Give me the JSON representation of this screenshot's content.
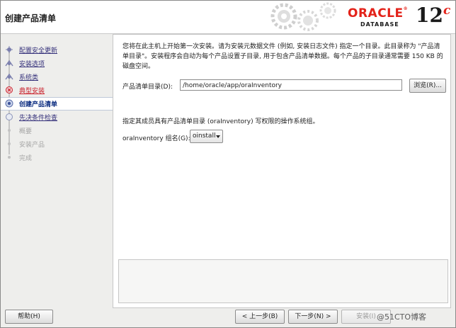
{
  "window": {
    "title": "创建产品清单"
  },
  "logo": {
    "brand": "ORACLE",
    "product": "DATABASE",
    "version": "12",
    "version_suffix": "c",
    "brand_color": "#e32219"
  },
  "sidebar": {
    "items": [
      {
        "label": "配置安全更新",
        "state": "done"
      },
      {
        "label": "安装选项",
        "state": "done"
      },
      {
        "label": "系统类",
        "state": "done"
      },
      {
        "label": "典型安装",
        "state": "warning"
      },
      {
        "label": "创建产品清单",
        "state": "current"
      },
      {
        "label": "先决条件检查",
        "state": "next"
      },
      {
        "label": "概要",
        "state": "disabled"
      },
      {
        "label": "安装产品",
        "state": "disabled"
      },
      {
        "label": "完成",
        "state": "disabled"
      }
    ]
  },
  "main": {
    "intro_text": "您将在此主机上开始第一次安装。请为安装元数据文件 (例如, 安装日志文件) 指定一个目录。此目录称为 \"产品清单目录\"。安装程序会自动为每个产品设置子目录, 用于包含产品清单数据。每个产品的子目录通常需要 150 KB 的磁盘空间。",
    "inventory_label": "产品清单目录(D):",
    "inventory_value": "/home/oracle/app/oraInventory",
    "browse_button": "浏览(R)...",
    "group_intro": "指定其成员具有产品清单目录 (oraInventory) 写权限的操作系统组。",
    "group_label": "oraInventory 组名(G):",
    "group_value": "oinstall"
  },
  "buttons": {
    "help": "帮助(H)",
    "back": "< 上一步(B)",
    "next": "下一步(N) >",
    "install": "安装(I)"
  },
  "watermark": "@51CTO博客"
}
